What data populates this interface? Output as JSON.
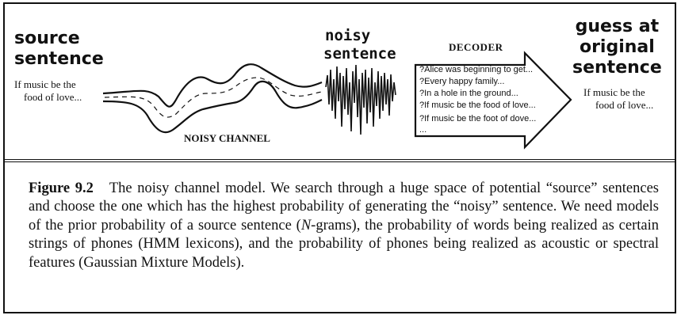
{
  "diagram": {
    "source": {
      "title_lines": [
        "source",
        "sentence"
      ],
      "text_lines": [
        "If music be the",
        "food of love..."
      ]
    },
    "noisy": {
      "title_lines": [
        "noisy",
        "sentence"
      ],
      "channel_label": "NOISY CHANNEL"
    },
    "decoder": {
      "label": "DECODER",
      "hypotheses": [
        "?Alice was beginning to get...",
        "?Every happy family...",
        "?In a hole in the ground...",
        "?If music be the food of love...",
        "?If music be the foot of dove...",
        "..."
      ]
    },
    "guess": {
      "title_lines": [
        "guess at",
        "original",
        "sentence"
      ],
      "text_lines": [
        "If music be the",
        "food of love..."
      ]
    }
  },
  "caption": {
    "label": "Figure 9.2",
    "text_part1": "The noisy channel model.  We search through a huge space of potential “source” sentences and choose the one which has the highest probability of generating the “noisy” sentence. We need models of the prior probability of a source sentence (",
    "ngram_italic": "N",
    "text_part2": "-grams), the probability of words being realized as certain strings of phones (HMM lexicons), and the probability of phones being realized as acoustic or spectral features (Gaussian Mixture Models)."
  }
}
